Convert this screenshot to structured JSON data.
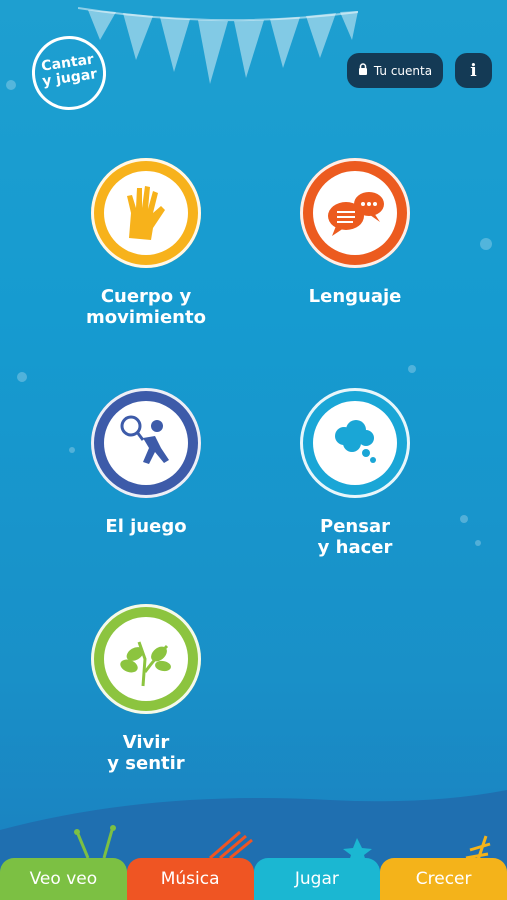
{
  "header": {
    "logo_line1": "Cantar",
    "logo_line2": "y jugar",
    "account_label": "Tu cuenta",
    "info_label": "i"
  },
  "categories": [
    {
      "label_line1": "Cuerpo y",
      "label_line2": "movimiento",
      "icon": "hands-icon",
      "color": "#f7b21b"
    },
    {
      "label_line1": "Lenguaje",
      "label_line2": "",
      "icon": "speech-bubbles-icon",
      "color": "#ec5b1f"
    },
    {
      "label_line1": "El juego",
      "label_line2": "",
      "icon": "child-playing-icon",
      "color": "#3d5ba9"
    },
    {
      "label_line1": "Pensar",
      "label_line2": "y hacer",
      "icon": "thought-cloud-icon",
      "color": "#1aa6d6"
    },
    {
      "label_line1": "Vivir",
      "label_line2": "y sentir",
      "icon": "leaves-icon",
      "color": "#8cc43f"
    }
  ],
  "nav": [
    {
      "label": "Veo veo",
      "color": "#7cc043"
    },
    {
      "label": "Música",
      "color": "#ef5523"
    },
    {
      "label": "Jugar",
      "color": "#1bb7d2"
    },
    {
      "label": "Crecer",
      "color": "#f4b31a"
    }
  ]
}
